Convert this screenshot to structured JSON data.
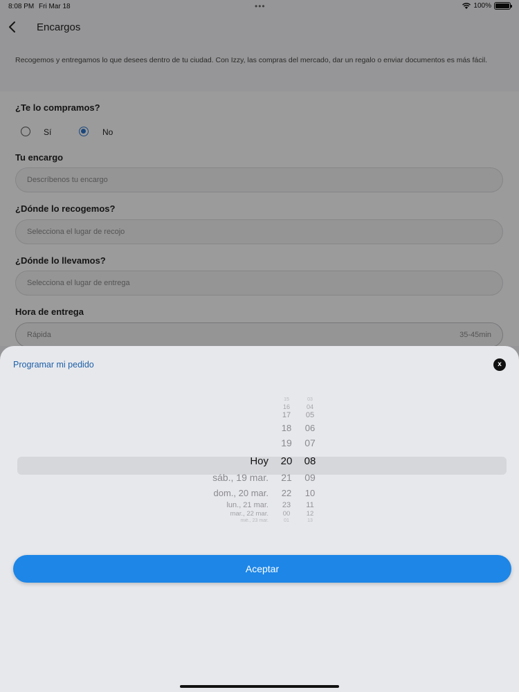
{
  "status_bar": {
    "time": "8:08 PM",
    "date": "Fri Mar 18",
    "dots": "•••",
    "battery": "100%"
  },
  "header": {
    "title": "Encargos"
  },
  "intro": "Recogemos y entregamos lo que desees dentro de tu ciudad. Con Izzy, las compras del mercado, dar un regalo o enviar documentos es más fácil.",
  "form": {
    "buy_question": "¿Te lo compramos?",
    "option_yes": "Sí",
    "option_no": "No",
    "selected": "No",
    "order_label": "Tu encargo",
    "order_placeholder": "Descríbenos tu encargo",
    "pickup_label": "¿Dónde lo recogemos?",
    "pickup_placeholder": "Selecciona el lugar de recojo",
    "dropoff_label": "¿Dónde lo llevamos?",
    "dropoff_placeholder": "Selecciona el lugar de entrega",
    "time_label": "Hora de entrega",
    "time_value": "Rápida",
    "time_estimate": "35-45min"
  },
  "sheet": {
    "title": "Programar mi pedido",
    "close_label": "x",
    "accept_label": "Aceptar"
  },
  "picker": {
    "days": [
      "Hoy",
      "sáb., 19 mar.",
      "dom., 20 mar.",
      "lun., 21 mar.",
      "mar., 22 mar.",
      "mié., 23 mar."
    ],
    "hours": [
      "15",
      "16",
      "17",
      "18",
      "19",
      "20",
      "21",
      "22",
      "23",
      "00",
      "01"
    ],
    "minutes": [
      "03",
      "04",
      "05",
      "06",
      "07",
      "08",
      "09",
      "10",
      "11",
      "12",
      "13"
    ],
    "selected_day": "Hoy",
    "selected_hour": "20",
    "selected_minute": "08"
  },
  "colors": {
    "accent": "#1d86e7",
    "title_blue": "#1d5fa8",
    "radio_blue": "#2b73c9"
  }
}
